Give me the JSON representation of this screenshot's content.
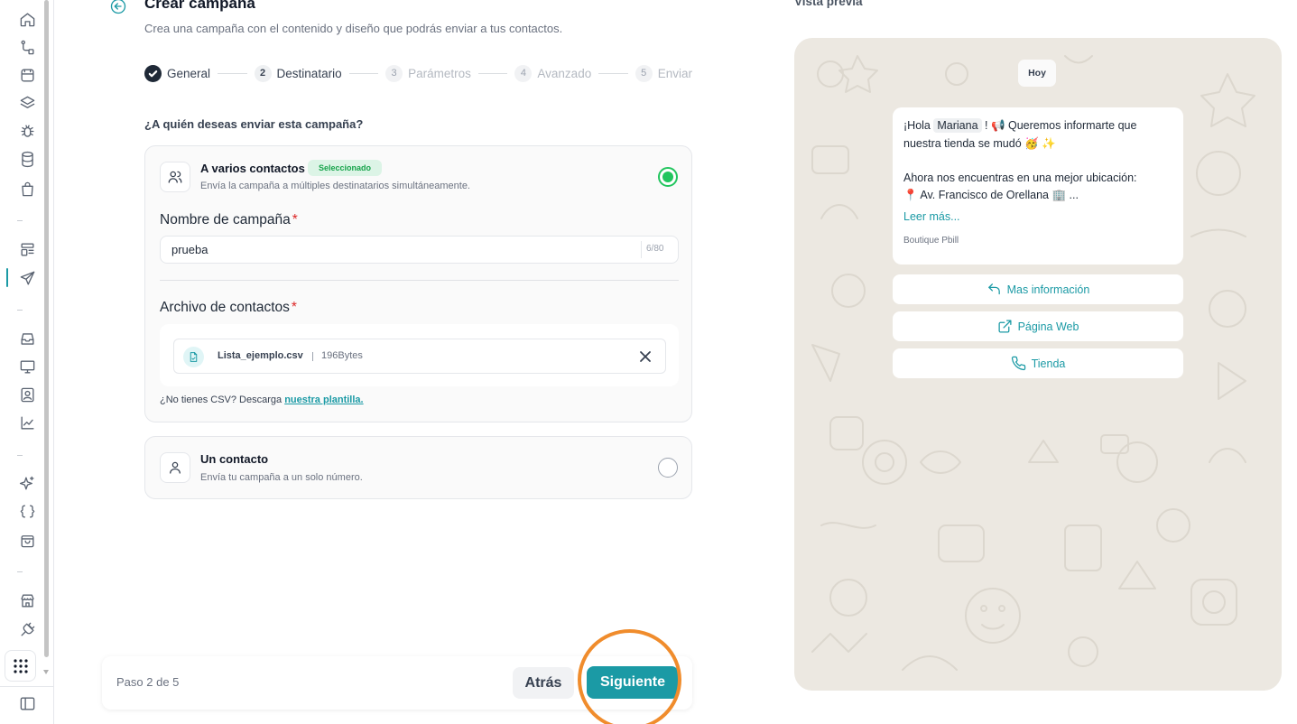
{
  "header": {
    "title": "Crear campaña",
    "subtitle": "Crea una campaña con el contenido y diseño que podrás enviar a tus contactos."
  },
  "stepper": {
    "steps": [
      {
        "number": "1",
        "label": "General",
        "state": "done"
      },
      {
        "number": "2",
        "label": "Destinatario",
        "state": "current"
      },
      {
        "number": "3",
        "label": "Parámetros",
        "state": "future"
      },
      {
        "number": "4",
        "label": "Avanzado",
        "state": "future"
      },
      {
        "number": "5",
        "label": "Enviar",
        "state": "future"
      }
    ]
  },
  "recipients": {
    "question": "¿A quién deseas enviar esta campaña?",
    "multiple": {
      "title": "A varios contactos",
      "badge": "Seleccionado",
      "description": "Envía la campaña a múltiples destinatarios simultáneamente.",
      "selected": true,
      "campaign_name_label": "Nombre de campaña",
      "campaign_name_value": "prueba",
      "campaign_name_count": "6/80",
      "contacts_file_label": "Archivo de contactos",
      "file_name": "Lista_ejemplo.csv",
      "file_size": "196Bytes",
      "csv_note": "¿No tienes CSV? Descarga",
      "csv_link": "nuestra plantilla."
    },
    "single": {
      "title": "Un contacto",
      "description": "Envía tu campaña a un solo número.",
      "selected": false
    }
  },
  "footer": {
    "step_count": "Paso 2 de 5",
    "back_label": "Atrás",
    "next_label": "Siguiente"
  },
  "preview": {
    "title": "Vista previa",
    "day_chip": "Hoy",
    "message": {
      "greeting": "¡Hola",
      "name_variable": "Mariana",
      "line1_rest": "! 📢 Queremos informarte que",
      "line2": "nuestra tienda se mudó 🥳 ✨",
      "line3": "Ahora nos encuentras en una mejor ubicación:",
      "line4": "📍 Av. Francisco de Orellana 🏢 ...",
      "read_more": "Leer más...",
      "footer": "Boutique Pbill"
    },
    "buttons": [
      {
        "label": "Mas información",
        "icon": "reply-icon"
      },
      {
        "label": "Página Web",
        "icon": "external-link-icon"
      },
      {
        "label": "Tienda",
        "icon": "phone-icon"
      }
    ]
  },
  "colors": {
    "accent": "#1b9aa5",
    "selected_green": "#22c55e",
    "highlight_ring": "#f08c2c",
    "preview_background": "#ece8e1"
  }
}
